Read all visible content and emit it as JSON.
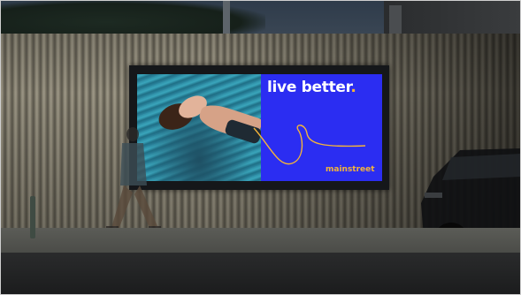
{
  "billboard": {
    "headline": "live better",
    "headline_punct": ".",
    "brand": "mainstreet"
  },
  "colors": {
    "panel_blue": "#2b2df2",
    "accent_orange": "#f4b43a",
    "fence": "#8b8674",
    "pool_water": "#2a7f96"
  }
}
